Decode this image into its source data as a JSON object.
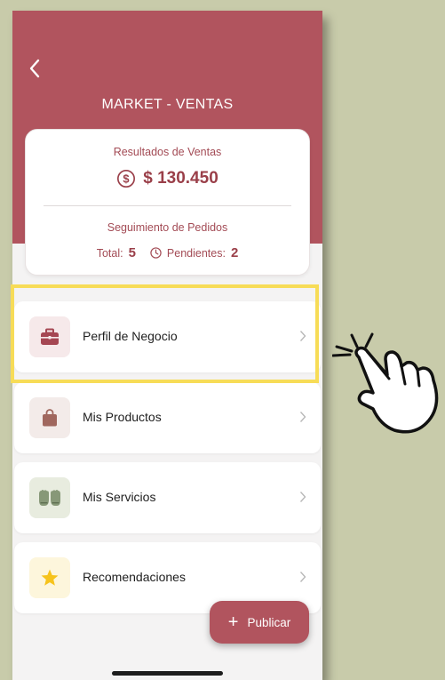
{
  "header": {
    "title": "MARKET - VENTAS",
    "back_icon": "chevron-left-icon"
  },
  "summary": {
    "sales_label": "Resultados de Ventas",
    "sales_value": "$ 130.450",
    "orders_label": "Seguimiento de Pedidos",
    "total_label": "Total:",
    "total_value": "5",
    "pending_label": "Pendientes:",
    "pending_value": "2"
  },
  "menu": [
    {
      "label": "Perfil de Negocio",
      "icon": "briefcase-icon",
      "icon_bg": "#f6e9ea",
      "icon_color": "#a54652"
    },
    {
      "label": "Mis Productos",
      "icon": "shopping-bag-icon",
      "icon_bg": "#f3ebe9",
      "icon_color": "#a0675e"
    },
    {
      "label": "Mis Servicios",
      "icon": "gloves-icon",
      "icon_bg": "#e8ecdf",
      "icon_color": "#879878"
    },
    {
      "label": "Recomendaciones",
      "icon": "star-icon",
      "icon_bg": "#fdf6dc",
      "icon_color": "#f6c31c"
    }
  ],
  "fab": {
    "label": "Publicar",
    "icon": "plus-icon"
  },
  "colors": {
    "primary": "#b1545e",
    "highlight": "#f7dc57",
    "background": "#c8cbaa"
  }
}
